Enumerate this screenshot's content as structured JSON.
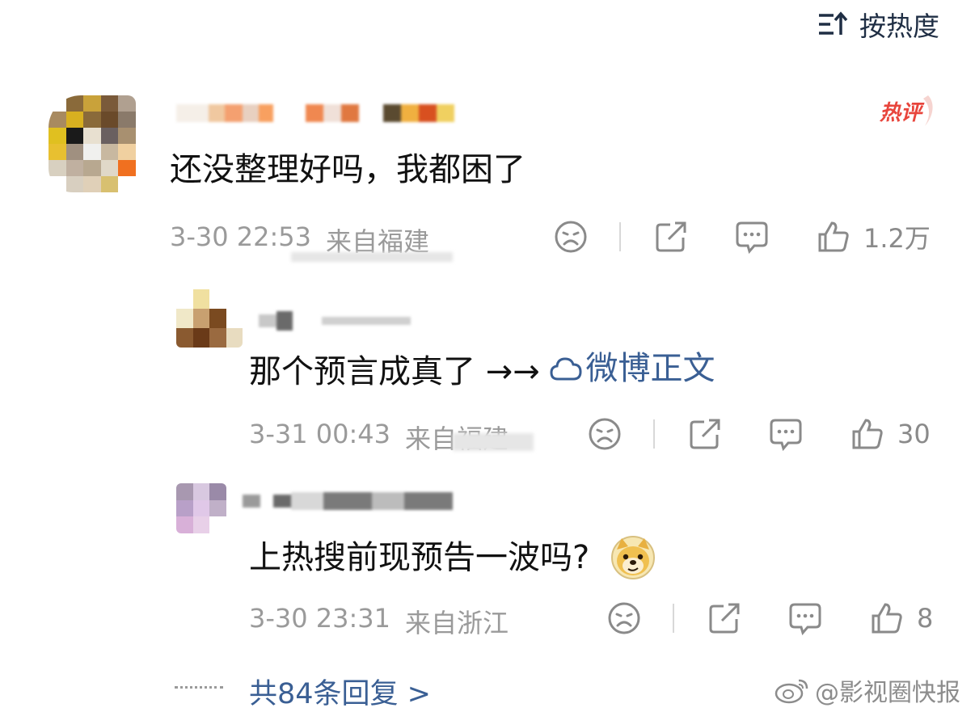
{
  "sort": {
    "label": "按热度",
    "icon": "sort-icon"
  },
  "hot_badge": {
    "label": "热评",
    "color": "#e8453c"
  },
  "comments": [
    {
      "text": "还没整理好吗，我都困了",
      "time": "3-30 22:53",
      "location": "来自福建",
      "likes": "1.2万"
    },
    {
      "text": "那个预言成真了 →→",
      "link_label": "微博正文",
      "time": "3-31 00:43",
      "location": "来自福建",
      "likes": "30"
    },
    {
      "text": "上热搜前现预告一波吗?",
      "emoji": "doge-emoji",
      "time": "3-30 23:31",
      "location": "来自浙江",
      "likes": "8"
    }
  ],
  "more_replies": "共84条回复 >",
  "watermark": "@影视圈快报",
  "colors": {
    "link": "#3a5f94",
    "meta": "#9a9a9a",
    "text": "#111111"
  }
}
